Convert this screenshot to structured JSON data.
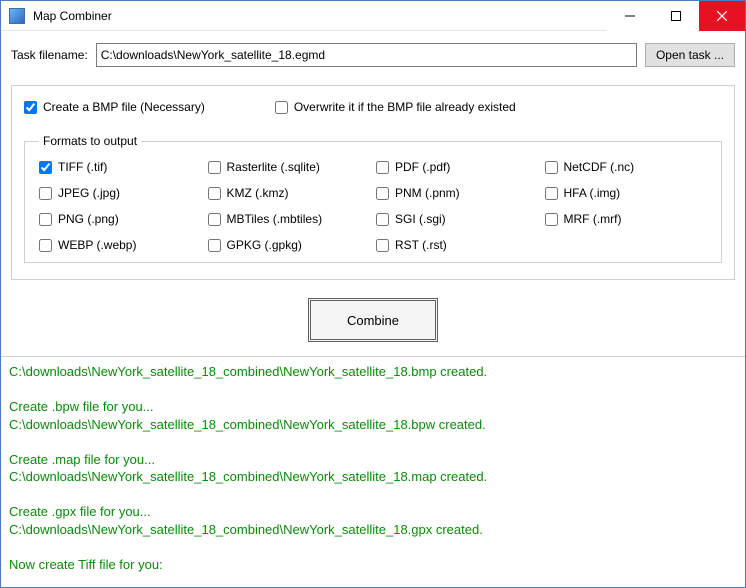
{
  "window": {
    "title": "Map Combiner"
  },
  "task": {
    "label": "Task filename:",
    "value": "C:\\downloads\\NewYork_satellite_18.egmd",
    "open_btn": "Open task ..."
  },
  "options": {
    "create_bmp": {
      "label": "Create a  BMP file (Necessary)",
      "checked": true
    },
    "overwrite": {
      "label": "Overwrite it if the BMP file already existed",
      "checked": false
    }
  },
  "formats": {
    "legend": "Formats to output",
    "items": [
      {
        "key": "tiff",
        "label": "TIFF (.tif)",
        "checked": true
      },
      {
        "key": "raster",
        "label": "Rasterlite (.sqlite)",
        "checked": false
      },
      {
        "key": "pdf",
        "label": "PDF (.pdf)",
        "checked": false
      },
      {
        "key": "netcdf",
        "label": "NetCDF (.nc)",
        "checked": false
      },
      {
        "key": "jpeg",
        "label": "JPEG (.jpg)",
        "checked": false
      },
      {
        "key": "kmz",
        "label": "KMZ (.kmz)",
        "checked": false
      },
      {
        "key": "pnm",
        "label": "PNM (.pnm)",
        "checked": false
      },
      {
        "key": "hfa",
        "label": "HFA (.img)",
        "checked": false
      },
      {
        "key": "png",
        "label": "PNG (.png)",
        "checked": false
      },
      {
        "key": "mbtiles",
        "label": "MBTiles (.mbtiles)",
        "checked": false
      },
      {
        "key": "sgi",
        "label": "SGI (.sgi)",
        "checked": false
      },
      {
        "key": "mrf",
        "label": "MRF (.mrf)",
        "checked": false
      },
      {
        "key": "webp",
        "label": "WEBP (.webp)",
        "checked": false
      },
      {
        "key": "gpkg",
        "label": "GPKG (.gpkg)",
        "checked": false
      },
      {
        "key": "rst",
        "label": "RST (.rst)",
        "checked": false
      }
    ]
  },
  "buttons": {
    "combine": "Combine"
  },
  "log_lines": [
    "C:\\downloads\\NewYork_satellite_18_combined\\NewYork_satellite_18.bmp created.",
    "",
    "Create .bpw file for you...",
    "C:\\downloads\\NewYork_satellite_18_combined\\NewYork_satellite_18.bpw created.",
    "",
    "Create .map file for you...",
    "C:\\downloads\\NewYork_satellite_18_combined\\NewYork_satellite_18.map created.",
    "",
    "Create .gpx file for you...",
    "C:\\downloads\\NewYork_satellite_18_combined\\NewYork_satellite_18.gpx created.",
    "",
    "Now create Tiff file for you:"
  ]
}
